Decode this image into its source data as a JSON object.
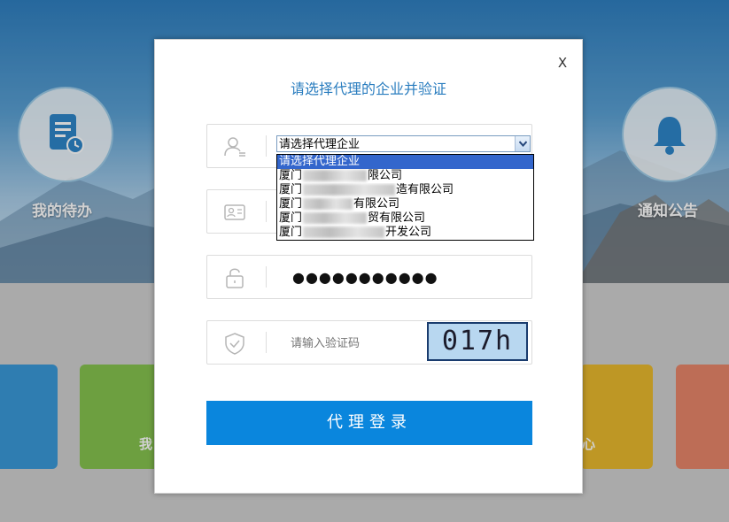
{
  "background": {
    "todo_label": "我的待办",
    "notice_label": "通知公告",
    "tile_left_text": "我",
    "tile_right_text": "心"
  },
  "modal": {
    "title": "请选择代理的企业并验证",
    "close_label": "X",
    "enterprise_select": {
      "selected": "请选择代理企业",
      "options": [
        {
          "prefix": "请选择代理企业",
          "suffix": ""
        },
        {
          "prefix": "厦门",
          "suffix": "限公司"
        },
        {
          "prefix": "厦门",
          "suffix": "造有限公司"
        },
        {
          "prefix": "厦门",
          "suffix": "有限公司"
        },
        {
          "prefix": "厦门",
          "suffix": "贸有限公司"
        },
        {
          "prefix": "厦门",
          "suffix": "开发公司"
        }
      ]
    },
    "password_mask": "●●●●●●●●●●●",
    "captcha_placeholder": "请输入验证码",
    "captcha_text": "017h",
    "login_button": "代理登录"
  },
  "colors": {
    "accent": "#0a86dd",
    "title": "#2a7dbf",
    "dropdown_selected": "#3366cc"
  }
}
